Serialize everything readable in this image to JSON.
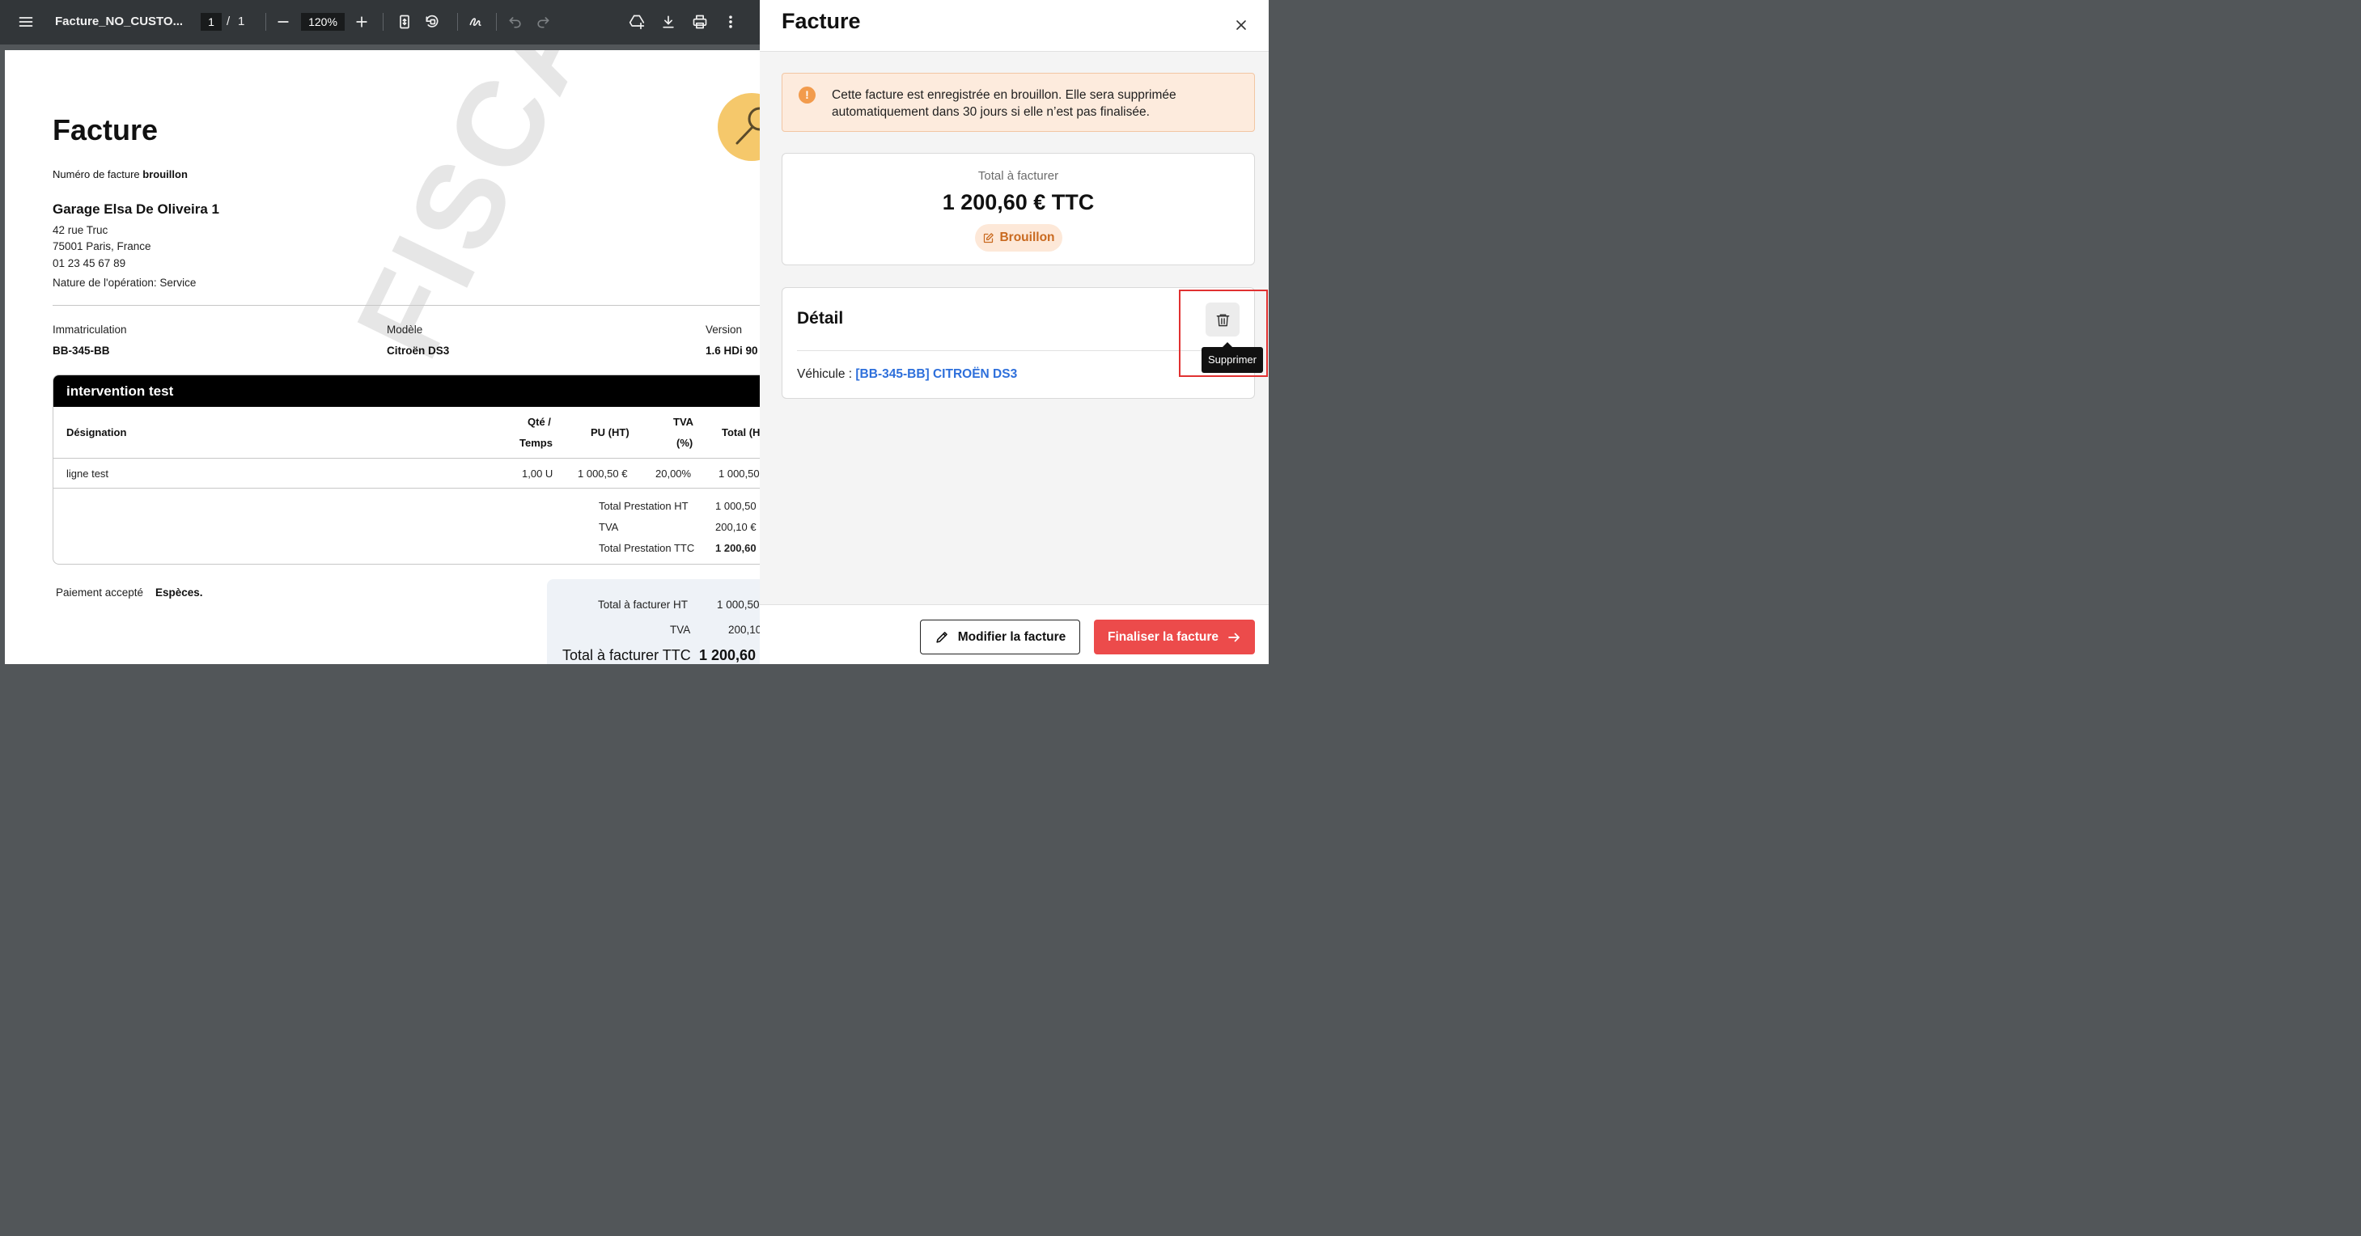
{
  "viewer": {
    "doc_title": "Facture_NO_CUSTO...",
    "page_current": "1",
    "page_sep": "/",
    "page_total": "1",
    "zoom": "120%"
  },
  "pdf": {
    "title": "Facture",
    "invoice_number_label": "Numéro de facture",
    "invoice_number_value": "brouillon",
    "garage_name": "Garage Elsa De Oliveira 1",
    "address_line1": "42 rue Truc",
    "address_line2": "75001 Paris, France",
    "phone": "01 23 45 67 89",
    "operation": "Nature de l'opération: Service",
    "vehicle": {
      "plate_label": "Immatriculation",
      "plate_value": "BB-345-BB",
      "model_label": "Modèle",
      "model_value": "Citroën DS3",
      "version_label": "Version",
      "version_value": "1.6 HDi 90"
    },
    "watermark": "FISCAL",
    "section": {
      "title": "intervention test",
      "headers": {
        "designation": "Désignation",
        "qty_line1": "Qté /",
        "qty_line2": "Temps",
        "pu": "PU (HT)",
        "tva_line1": "TVA",
        "tva_line2": "(%)",
        "total": "Total (H"
      },
      "row": {
        "designation": "ligne test",
        "qty": "1,00 U",
        "pu": "1 000,50 €",
        "tva": "20,00%",
        "total": "1 000,50"
      },
      "subtotals": [
        {
          "label": "Total Prestation HT",
          "value": "1 000,50"
        },
        {
          "label": "TVA",
          "value": "200,10 €"
        },
        {
          "label": "Total Prestation TTC",
          "value": "1 200,60"
        }
      ]
    },
    "payment_label": "Paiement accepté",
    "payment_value": "Espèces.",
    "totals": [
      {
        "label": "Total à facturer HT",
        "value": "1 000,50"
      },
      {
        "label": "TVA",
        "value": "200,10"
      },
      {
        "label": "Total à facturer TTC",
        "value": "1 200,60"
      }
    ]
  },
  "panel": {
    "title": "Facture",
    "alert_text": "Cette facture est enregistrée en brouillon. Elle sera supprimée automatiquement dans 30 jours si elle n’est pas finalisée.",
    "alert_icon": "!",
    "total_label": "Total à facturer",
    "total_amount": "1 200,60 € TTC",
    "status_badge": "Brouillon",
    "detail_title": "Détail",
    "vehicle_label": "Véhicule :",
    "vehicle_link": "[BB-345-BB] CITROËN DS3",
    "delete_tooltip": "Supprimer",
    "edit_button": "Modifier la facture",
    "finalize_button": "Finaliser la facture"
  },
  "colors": {
    "accent_red": "#ec4b4b",
    "link_blue": "#2d6fdb",
    "draft_orange": "#c96a20",
    "alert_bg": "#fdebdd",
    "viewer_toolbar": "#323639"
  }
}
